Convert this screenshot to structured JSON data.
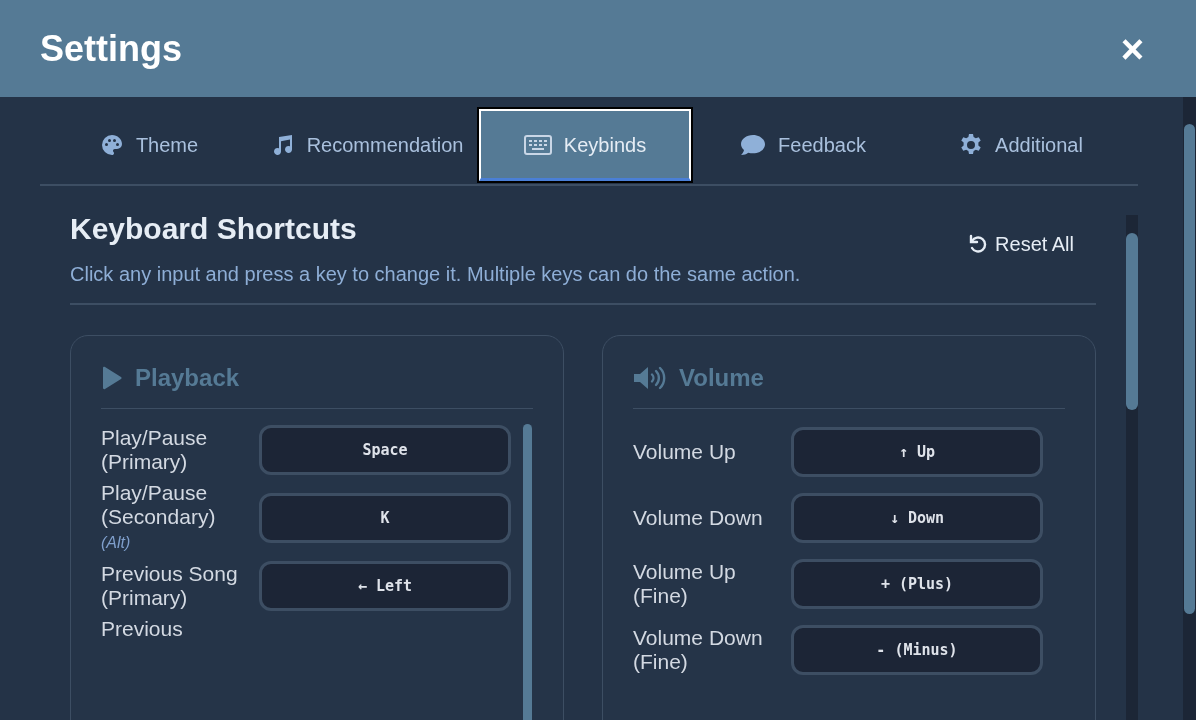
{
  "window": {
    "title": "Settings",
    "close": "×"
  },
  "tabs": [
    {
      "label": "Theme",
      "selected": false
    },
    {
      "label": "Recommendation",
      "selected": false
    },
    {
      "label": "Keybinds",
      "selected": true
    },
    {
      "label": "Feedback",
      "selected": false
    },
    {
      "label": "Additional",
      "selected": false
    }
  ],
  "section": {
    "title": "Keyboard Shortcuts",
    "description": "Click any input and press a key to change it. Multiple keys can do the same action.",
    "reset": "Reset All"
  },
  "groups": [
    {
      "title": "Playback",
      "rows": [
        {
          "label": "Play/Pause (Primary)",
          "key": "Space"
        },
        {
          "label": "Play/Pause (Secondary)",
          "note": "(Alt)",
          "key": "K"
        },
        {
          "label": "Previous Song (Primary)",
          "key": "← Left"
        },
        {
          "label": "Previous"
        }
      ]
    },
    {
      "title": "Volume",
      "rows": [
        {
          "label": "Volume Up",
          "key": "↑ Up"
        },
        {
          "label": "Volume Down",
          "key": "↓ Down"
        },
        {
          "label": "Volume Up (Fine)",
          "key": "+ (Plus)"
        },
        {
          "label": "Volume Down (Fine)",
          "key": "- (Minus)"
        }
      ]
    }
  ]
}
